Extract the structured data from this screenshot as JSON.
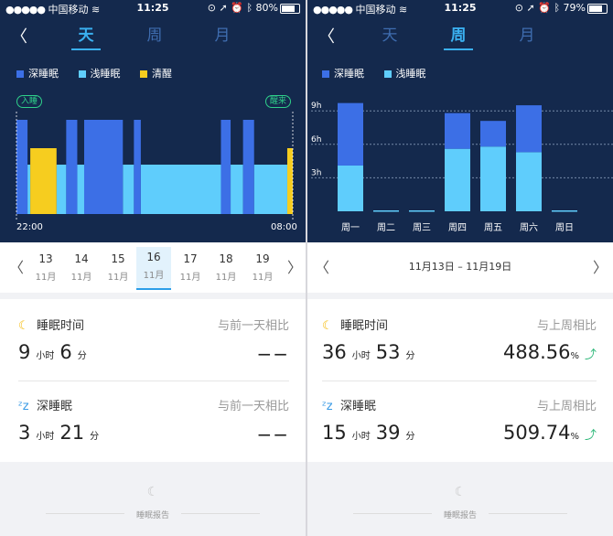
{
  "colors": {
    "deep": "#3c6fe6",
    "light": "#5fcdfc",
    "awake": "#f6cd1f",
    "bg": "#14294d"
  },
  "left": {
    "status": {
      "carrier": "中国移动",
      "time": "11:25",
      "battery": "80%",
      "battery_level": 0.8
    },
    "tabs": [
      "天",
      "周",
      "月"
    ],
    "active_tab": 0,
    "legend": [
      {
        "label": "深睡眠",
        "color": "#3c6fe6"
      },
      {
        "label": "浅睡眠",
        "color": "#5fcdfc"
      },
      {
        "label": "清醒",
        "color": "#f6cd1f"
      }
    ],
    "chip_start": "入睡",
    "chip_end": "醒来",
    "time_start": "22:00",
    "time_end": "08:00",
    "dates": [
      {
        "d": "13",
        "m": "11月"
      },
      {
        "d": "14",
        "m": "11月"
      },
      {
        "d": "15",
        "m": "11月"
      },
      {
        "d": "16",
        "m": "11月"
      },
      {
        "d": "17",
        "m": "11月"
      },
      {
        "d": "18",
        "m": "11月"
      },
      {
        "d": "19",
        "m": "11月"
      }
    ],
    "selected_date": 3,
    "sleep_title": "睡眠时间",
    "compare_label": "与前一天相比",
    "sleep_hours": "9",
    "hours_unit": "小时",
    "sleep_minutes": "6",
    "minutes_unit": "分",
    "sleep_compare": "−−",
    "deep_title": "深睡眠",
    "deep_hours": "3",
    "deep_minutes": "21",
    "deep_compare": "−−",
    "report": "睡眠报告"
  },
  "right": {
    "status": {
      "carrier": "中国移动",
      "time": "11:25",
      "battery": "79%",
      "battery_level": 0.79
    },
    "tabs": [
      "天",
      "周",
      "月"
    ],
    "active_tab": 1,
    "legend": [
      {
        "label": "深睡眠",
        "color": "#3c6fe6"
      },
      {
        "label": "浅睡眠",
        "color": "#5fcdfc"
      }
    ],
    "week_range": "11月13日 – 11月19日",
    "sleep_title": "睡眠时间",
    "compare_label": "与上周相比",
    "sleep_hours": "36",
    "hours_unit": "小时",
    "sleep_minutes": "53",
    "minutes_unit": "分",
    "sleep_pct": "488.56",
    "pct_unit": "%",
    "deep_title": "深睡眠",
    "deep_hours": "15",
    "deep_minutes": "39",
    "deep_pct": "509.74",
    "report": "睡眠报告"
  },
  "chart_data": [
    {
      "type": "area",
      "title": "",
      "x_start": "22:00",
      "x_end": "08:00",
      "legend": [
        "深睡眠",
        "浅睡眠",
        "清醒"
      ],
      "series": [
        {
          "name": "深睡眠",
          "segments": [
            [
              0.0,
              0.04
            ],
            [
              0.18,
              0.22
            ],
            [
              0.245,
              0.385
            ],
            [
              0.425,
              0.45
            ],
            [
              0.74,
              0.775
            ],
            [
              0.82,
              0.86
            ]
          ]
        },
        {
          "name": "浅睡眠",
          "segments": [
            [
              0.04,
              0.05
            ],
            [
              0.145,
              0.18
            ],
            [
              0.22,
              0.245
            ],
            [
              0.385,
              0.425
            ],
            [
              0.45,
              0.74
            ],
            [
              0.775,
              0.82
            ],
            [
              0.86,
              0.98
            ]
          ]
        },
        {
          "name": "清醒",
          "segments": [
            [
              0.05,
              0.145
            ],
            [
              0.98,
              1.0
            ]
          ]
        }
      ]
    },
    {
      "type": "bar",
      "stacked": true,
      "categories": [
        "周一",
        "周二",
        "周三",
        "周四",
        "周五",
        "周六",
        "周日"
      ],
      "yticks": [
        "3h",
        "6h",
        "9h"
      ],
      "ylim": [
        0,
        10
      ],
      "series": [
        {
          "name": "浅睡眠",
          "values": [
            4.1,
            0,
            0,
            5.6,
            5.8,
            5.3,
            0
          ]
        },
        {
          "name": "深睡眠",
          "values": [
            5.6,
            0,
            0,
            3.2,
            2.3,
            4.2,
            0
          ]
        }
      ]
    }
  ]
}
